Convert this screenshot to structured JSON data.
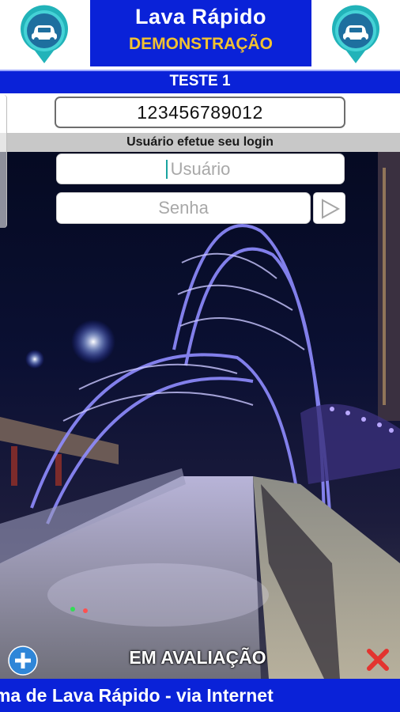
{
  "header": {
    "title": "Lava Rápido",
    "subtitle": "DEMONSTRAÇÃO",
    "left_icon": "car-location-pin-icon",
    "right_icon": "car-location-pin-icon"
  },
  "account_bar": {
    "label": "TESTE 1"
  },
  "code_field": {
    "value": "123456789012"
  },
  "login": {
    "prompt": "Usuário efetue seu login",
    "user_placeholder": "Usuário",
    "password_placeholder": "Senha",
    "submit_icon": "play-arrow-icon"
  },
  "footer": {
    "add_icon": "plus-circle-icon",
    "status_label": "EM AVALIAÇÃO",
    "close_icon": "red-x-icon",
    "ticker_text": "Sistema de Lava Rápido - via Internet"
  },
  "colors": {
    "brand_blue": "#0a22d8",
    "brand_yellow": "#f2c230",
    "pin_teal": "#28b9bf",
    "close_red": "#e3342f"
  }
}
